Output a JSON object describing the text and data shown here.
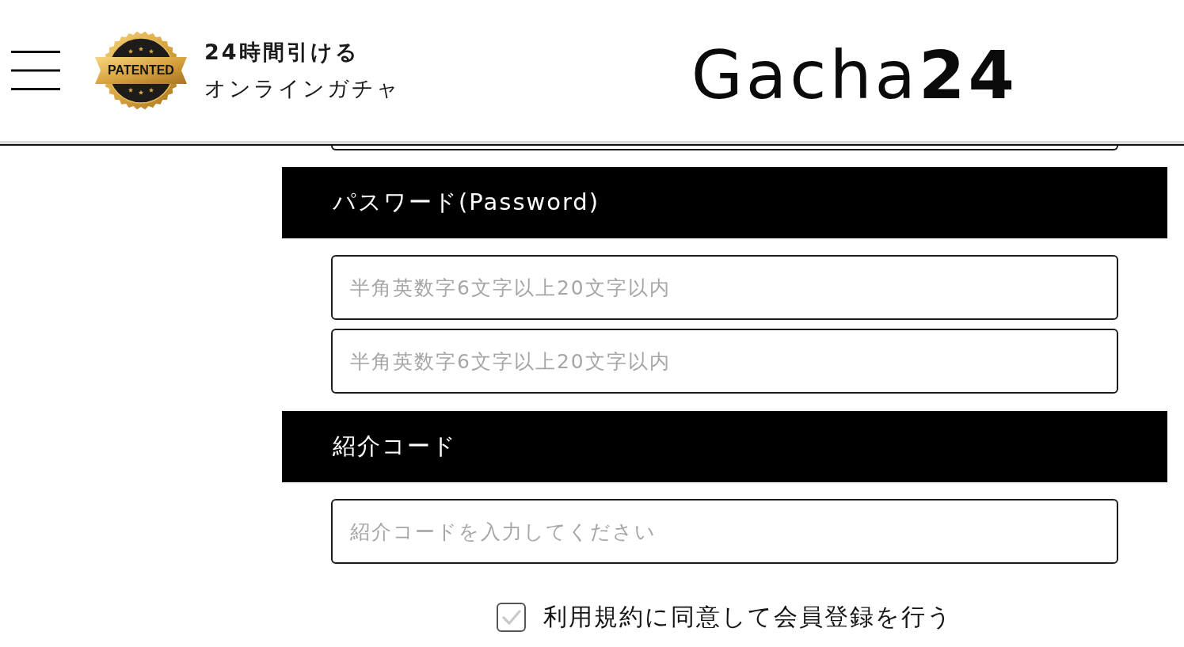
{
  "header": {
    "badge": {
      "label": "PATENTED"
    },
    "tagline": [
      "24時間引ける",
      "オンラインガチャ"
    ],
    "logo": "Gacha**24**"
  },
  "sections": [
    {
      "title": "パスワード(Password)",
      "fields": [
        {
          "placeholder": "半角英数字6文字以上20文字以内"
        },
        {
          "placeholder": "半角英数字6文字以上20文字以内"
        }
      ]
    },
    {
      "title": "紹介コード",
      "fields": [
        {
          "placeholder": "紹介コードを入力してください"
        }
      ]
    }
  ],
  "agreement": {
    "label": "利用規約に同意して会員登録を行う",
    "checked": false
  }
}
